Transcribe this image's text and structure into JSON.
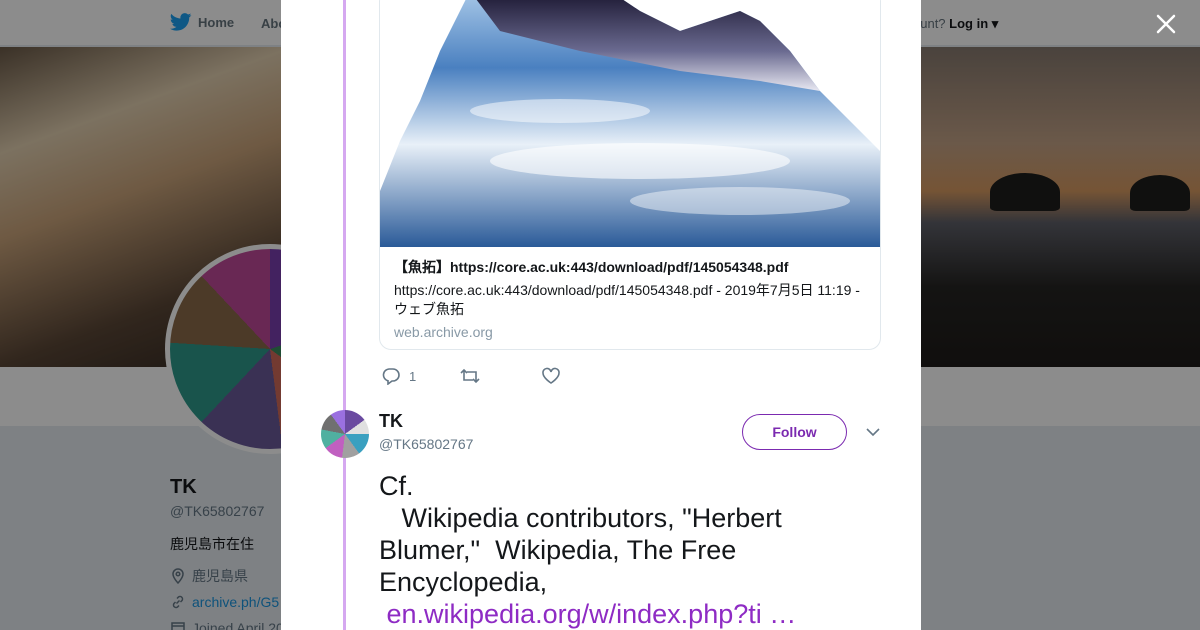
{
  "nav": {
    "home_label": "Home",
    "about_label": "Abo",
    "account_prompt": "ccount?",
    "login_label": "Log in"
  },
  "profile": {
    "name": "TK",
    "handle": "@TK65802767",
    "bio": "鹿児島市在住",
    "location": "鹿児島県",
    "url": "archive.ph/G5",
    "joined": "Joined April 20"
  },
  "card": {
    "title": "【魚拓】https://core.ac.uk:443/download/pdf/145054348.pdf",
    "description": "https://core.ac.uk:443/download/pdf/145054348.pdf - 2019年7月5日 11:19 - ウェブ魚拓",
    "domain": "web.archive.org"
  },
  "tweet1_actions": {
    "reply_count": "1",
    "retweet_count": "",
    "like_count": ""
  },
  "tweet2": {
    "name": "TK",
    "handle": "@TK65802767",
    "follow_label": "Follow",
    "text": "Cf.\n   Wikipedia contributors, \"Herbert Blumer,\"  Wikipedia, The Free Encyclopedia,",
    "link_text": " en.wikipedia.org/w/index.php?ti …"
  },
  "colors": {
    "accent": "#7b2ab0",
    "thread_line": "#d5a8f0",
    "link": "#8e2bc4"
  }
}
